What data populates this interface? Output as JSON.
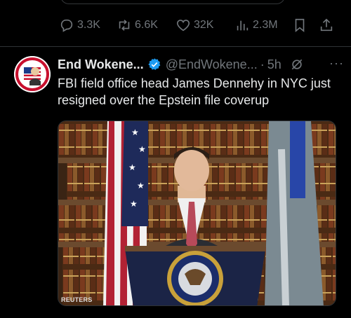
{
  "actions": {
    "reply_count": "3.3K",
    "retweet_count": "6.6K",
    "like_count": "32K",
    "view_count": "2.3M",
    "icons": [
      "reply-icon",
      "retweet-icon",
      "heart-icon",
      "views-icon",
      "bookmark-icon",
      "share-icon"
    ]
  },
  "post": {
    "display_name": "End Wokene...",
    "handle": "@EndWokene...",
    "separator": "·",
    "time": "5h",
    "more": "···",
    "text": "FBI field office head James Dennehy in NYC just resigned over the Epstein file coverup",
    "media": {
      "credit": "REUTERS",
      "avatar_badge_text": [
        "END WOKENESS",
        "FIGHTER THINGS"
      ]
    }
  },
  "colors": {
    "background": "#000000",
    "text": "#e7e9ea",
    "muted": "#71767b",
    "verified": "#1d9bf0",
    "divider": "#2f3336"
  }
}
